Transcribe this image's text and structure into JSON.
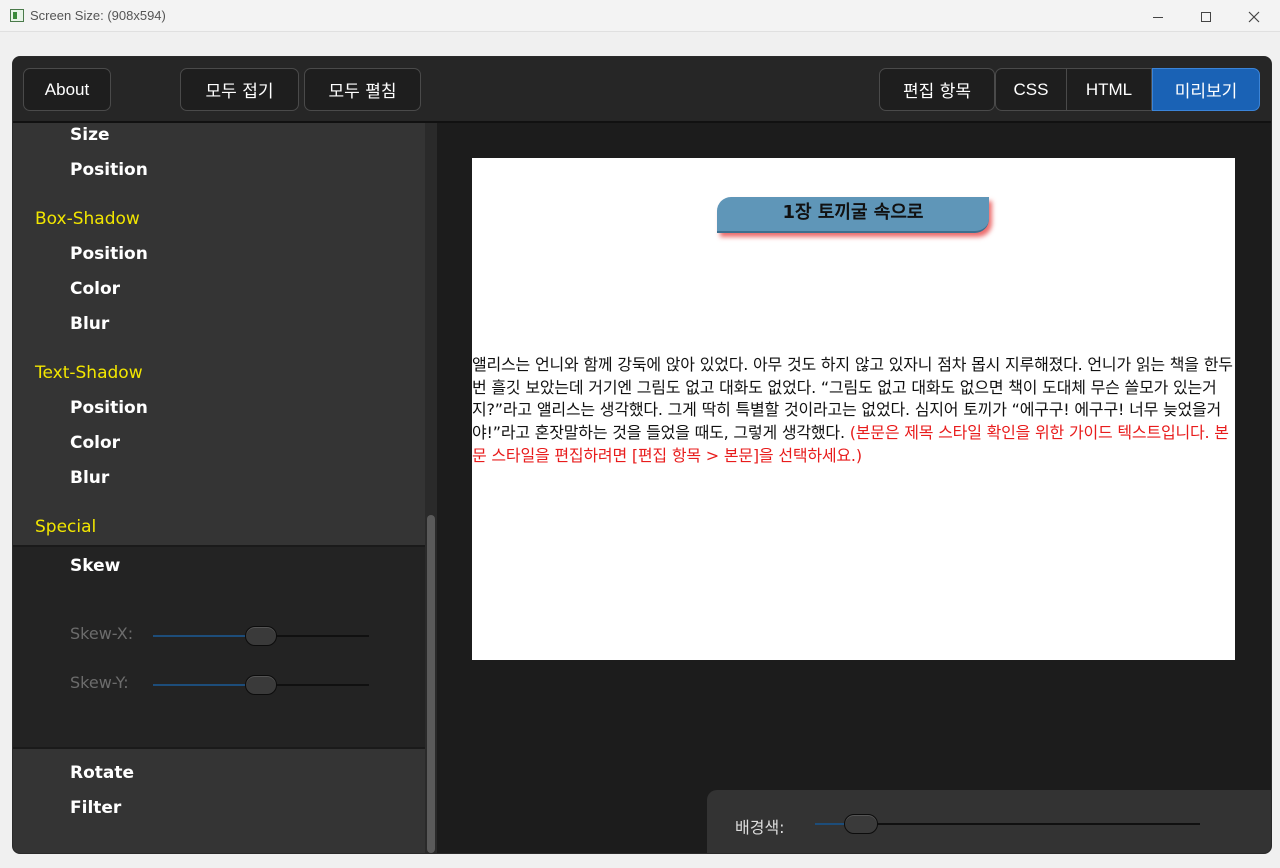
{
  "window": {
    "title": "Screen Size: (908x594)"
  },
  "toolbar": {
    "about": "About",
    "collapse_all": "모두 접기",
    "expand_all": "모두 펼침",
    "edit_items": "편집 항목",
    "css": "CSS",
    "html": "HTML",
    "preview": "미리보기",
    "active_tab": "미리보기",
    "active_color": "#1a62b5"
  },
  "sidebar": {
    "items": [
      {
        "type": "item",
        "label": "Size"
      },
      {
        "type": "item",
        "label": "Position"
      },
      {
        "type": "section",
        "label": "Box-Shadow"
      },
      {
        "type": "item",
        "label": "Position"
      },
      {
        "type": "item",
        "label": "Color"
      },
      {
        "type": "item",
        "label": "Blur"
      },
      {
        "type": "section",
        "label": "Text-Shadow"
      },
      {
        "type": "item",
        "label": "Position"
      },
      {
        "type": "item",
        "label": "Color"
      },
      {
        "type": "item",
        "label": "Blur"
      },
      {
        "type": "section",
        "label": "Special"
      }
    ],
    "skew": {
      "title": "Skew",
      "skew_x_label": "Skew-X:",
      "skew_x_value": 0.5,
      "skew_y_label": "Skew-Y:",
      "skew_y_value": 0.5
    },
    "after_items": [
      {
        "type": "item",
        "label": "Rotate"
      },
      {
        "type": "item",
        "label": "Filter"
      }
    ],
    "section_color": "#f2e600"
  },
  "preview": {
    "chapter_title": "1장 토끼굴 속으로",
    "body_text": "앨리스는 언니와 함께 강둑에 앉아 있었다. 아무 것도 하지 않고 있자니 점차 몹시 지루해졌다. 언니가 읽는 책을 한두 번 흘깃 보았는데 거기엔 그림도 없고 대화도 없었다. “그림도 없고 대화도 없으면 책이 도대체 무슨 쓸모가 있는거지?”라고 앨리스는 생각했다. 그게 딱히 특별할 것이라고는 없었다. 심지어 토끼가 “에구구! 에구구! 너무 늦었을거야!”라고 혼잣말하는 것을 들었을 때도, 그렇게 생각했다.",
    "guide_text": "(본문은 제목 스타일 확인을 위한 가이드 텍스트입니다. 본문 스타일을 편집하려면 [편집 항목 > 본문]을 선택하세요.)",
    "guide_color": "#e81c1c",
    "title_bg_color": "#5f96b8"
  },
  "background": {
    "label": "배경색:",
    "value": 0.12
  }
}
